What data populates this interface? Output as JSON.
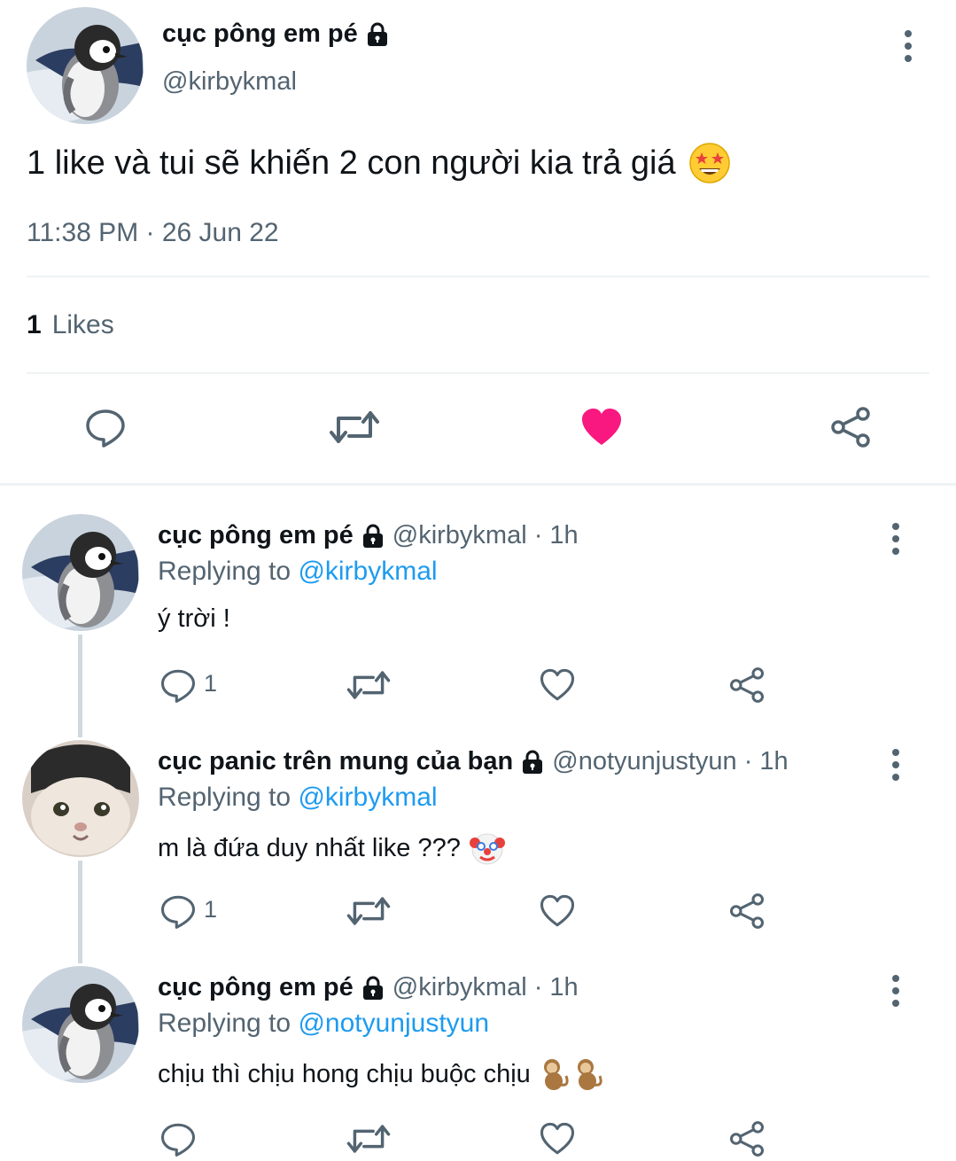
{
  "main_tweet": {
    "name": "cục pông em pé",
    "handle": "@kirbykmal",
    "text": "1 like và tui sẽ khiến 2 con người kia trả giá",
    "emoji": "star-struck-emoji",
    "timestamp": "11:38 PM · 26 Jun 22",
    "likes_count": "1",
    "likes_label": "Likes"
  },
  "replies": [
    {
      "name": "cục pông em pé",
      "handle_time": "@kirbykmal · 1h",
      "replying_prefix": "Replying to",
      "replying_to": "@kirbykmal",
      "text": "ý trời !",
      "reply_count": "1",
      "avatar": "penguin-chick"
    },
    {
      "name": "cục panic trên mung của bạn",
      "handle_time": "@notyunjustyun · 1h",
      "replying_prefix": "Replying to",
      "replying_to": "@kirbykmal",
      "text": "m là đứa duy nhất like ???",
      "emoji": "clown-face-emoji",
      "reply_count": "1",
      "avatar": "cat-face"
    },
    {
      "name": "cục pông em pé",
      "handle_time": "@kirbykmal · 1h",
      "replying_prefix": "Replying to",
      "replying_to": "@notyunjustyun",
      "text": "chịu thì chịu hong chịu buộc chịu",
      "emoji": "monkey-emoji",
      "reply_count": "",
      "avatar": "penguin-chick"
    }
  ],
  "colors": {
    "text": "#0f1419",
    "secondary": "#536471",
    "link": "#1d9bf0",
    "like": "#f91880",
    "divider": "#eff3f4"
  }
}
